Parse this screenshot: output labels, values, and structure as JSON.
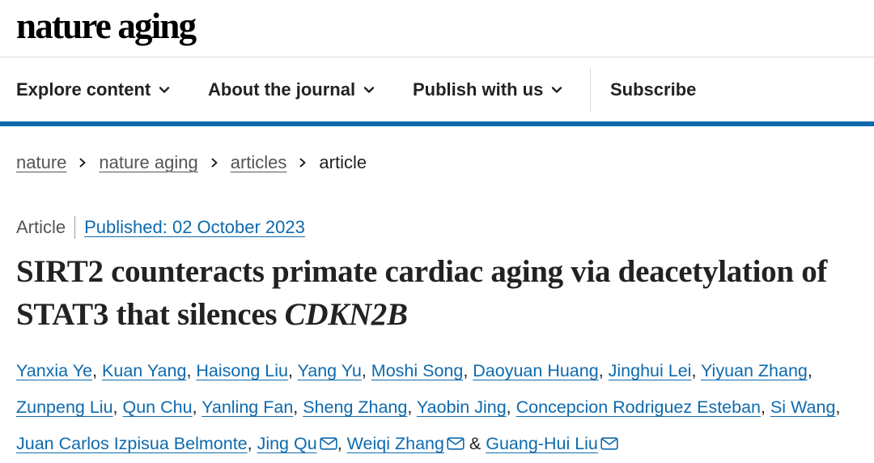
{
  "brand": {
    "logo_text": "nature aging"
  },
  "nav": {
    "items": [
      {
        "label": "Explore content",
        "has_dropdown": true
      },
      {
        "label": "About the journal",
        "has_dropdown": true
      },
      {
        "label": "Publish with us",
        "has_dropdown": true
      },
      {
        "label": "Subscribe",
        "has_dropdown": false
      }
    ],
    "accent_color": "#0e6aae"
  },
  "breadcrumb": {
    "items": [
      {
        "label": "nature"
      },
      {
        "label": "nature aging"
      },
      {
        "label": "articles"
      },
      {
        "label": "article"
      }
    ]
  },
  "article": {
    "type": "Article",
    "published": "Published: 02 October 2023",
    "title_main": "SIRT2 counteracts primate cardiac aging via deacetylation of STAT3 that silences ",
    "title_gene": "CDKN2B",
    "authors": [
      {
        "name": "Yanxia Ye",
        "sep": ", "
      },
      {
        "name": "Kuan Yang",
        "sep": ", "
      },
      {
        "name": "Haisong Liu",
        "sep": ", "
      },
      {
        "name": "Yang Yu",
        "sep": ", "
      },
      {
        "name": "Moshi Song",
        "sep": ", "
      },
      {
        "name": "Daoyuan Huang",
        "sep": ", "
      },
      {
        "name": "Jinghui Lei",
        "sep": ", "
      },
      {
        "name": "Yiyuan Zhang",
        "sep": ", "
      },
      {
        "name": "Zunpeng Liu",
        "sep": ", "
      },
      {
        "name": "Qun Chu",
        "sep": ", "
      },
      {
        "name": "Yanling Fan",
        "sep": ", "
      },
      {
        "name": "Sheng Zhang",
        "sep": ", "
      },
      {
        "name": "Yaobin Jing",
        "sep": ", "
      },
      {
        "name": "Concepcion Rodriguez Esteban",
        "sep": ", "
      },
      {
        "name": "Si Wang",
        "sep": ", "
      },
      {
        "name": "Juan Carlos Izpisua Belmonte",
        "sep": ", "
      },
      {
        "name": "Jing Qu",
        "sep": ", ",
        "email": true
      },
      {
        "name": "Weiqi Zhang",
        "sep": " & ",
        "email": true
      },
      {
        "name": "Guang-Hui Liu",
        "sep": "",
        "email": true
      }
    ]
  }
}
